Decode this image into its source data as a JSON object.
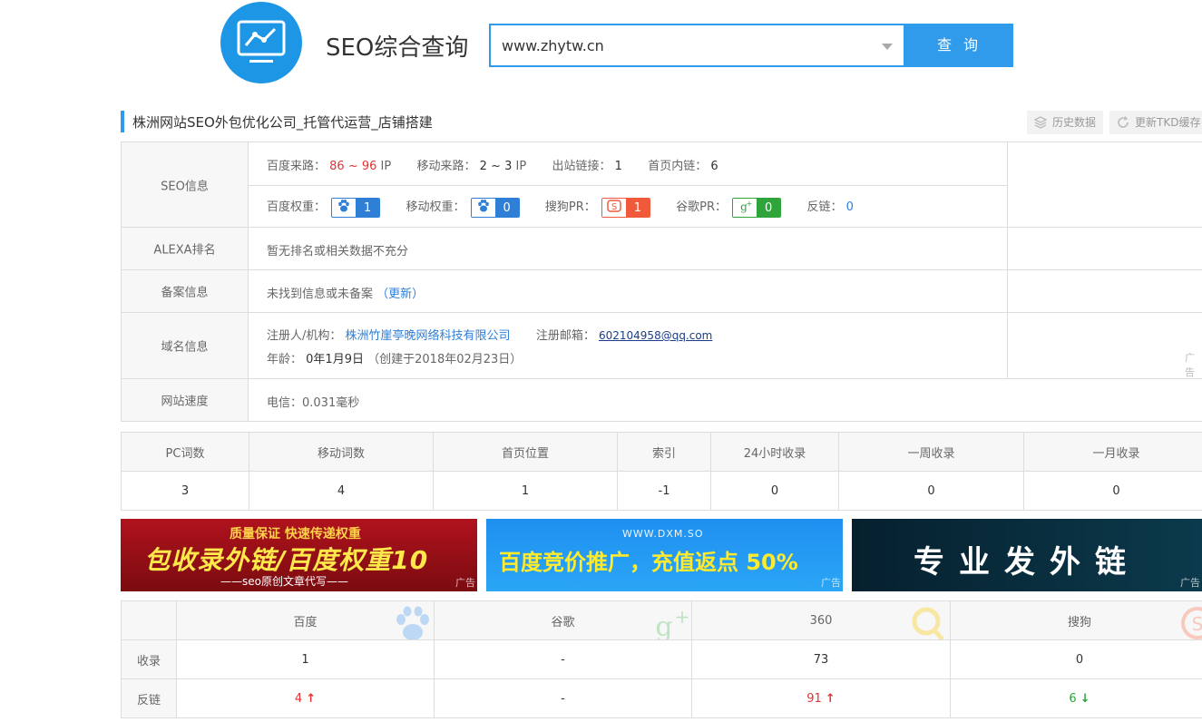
{
  "header": {
    "brand": "SEO综合查询",
    "search_value": "www.zhytw.cn",
    "search_button": "查 询"
  },
  "site": {
    "title": "株洲网站SEO外包优化公司_托管代运营_店铺搭建",
    "history_button": "历史数据",
    "tkd_button": "更新TKD缓存"
  },
  "seo_info": {
    "label": "SEO信息",
    "baidu_traffic_label": "百度来路：",
    "baidu_traffic_value": "86 ~ 96",
    "baidu_traffic_unit": "IP",
    "mobile_traffic_label": "移动来路：",
    "mobile_traffic_value": "2 ~ 3",
    "mobile_traffic_unit": "IP",
    "outbound_label": "出站链接：",
    "outbound_value": "1",
    "homepage_links_label": "首页内链：",
    "homepage_links_value": "6",
    "baidu_weight_label": "百度权重：",
    "baidu_weight_value": "1",
    "mobile_weight_label": "移动权重：",
    "mobile_weight_value": "0",
    "sogou_pr_label": "搜狗PR：",
    "sogou_pr_value": "1",
    "google_pr_label": "谷歌PR：",
    "google_pr_value": "0",
    "backlinks_label": "反链：",
    "backlinks_value": "0"
  },
  "alexa": {
    "label": "ALEXA排名",
    "value": "暂无排名或相关数据不充分"
  },
  "beian": {
    "label": "备案信息",
    "value": "未找到信息或未备案",
    "update_link": "（更新）"
  },
  "domain": {
    "label": "域名信息",
    "registrant_label": "注册人/机构：",
    "registrant_value": "株洲竹崖亭晚网络科技有限公司",
    "email_label": "注册邮箱：",
    "email_value": "602104958@qq.com",
    "age_label": "年龄：",
    "age_value": "0年1月9日",
    "created": "（创建于2018年02月23日）"
  },
  "speed": {
    "label": "网站速度",
    "value": "电信：0.031毫秒"
  },
  "side_ad": "广告",
  "stats": {
    "headers": [
      "PC词数",
      "移动词数",
      "首页位置",
      "索引",
      "24小时收录",
      "一周收录",
      "一月收录"
    ],
    "values": [
      "3",
      "4",
      "1",
      "-1",
      "0",
      "0",
      "0"
    ]
  },
  "banners": {
    "b1_line1": "质量保证  快速传递权重",
    "b1_line2": "包收录外链/百度权重10",
    "b1_line3": "——seo原创文章代写——",
    "b2_line1": "WWW.DXM.SO",
    "b2_line2": "百度竞价推广，充值返点 50%",
    "b3_line1": "专业发外链",
    "ad_tag": "广告"
  },
  "engines": {
    "headers": [
      "百度",
      "谷歌",
      "360",
      "搜狗"
    ],
    "rows": [
      {
        "label": "收录",
        "values": [
          "1",
          "-",
          "73",
          "0"
        ]
      },
      {
        "label": "反链",
        "values": [
          "4",
          "-",
          "91",
          "6"
        ]
      }
    ]
  },
  "colors": {
    "accent": "#2f9bea",
    "red": "#e53333",
    "green": "#2ea43a"
  }
}
